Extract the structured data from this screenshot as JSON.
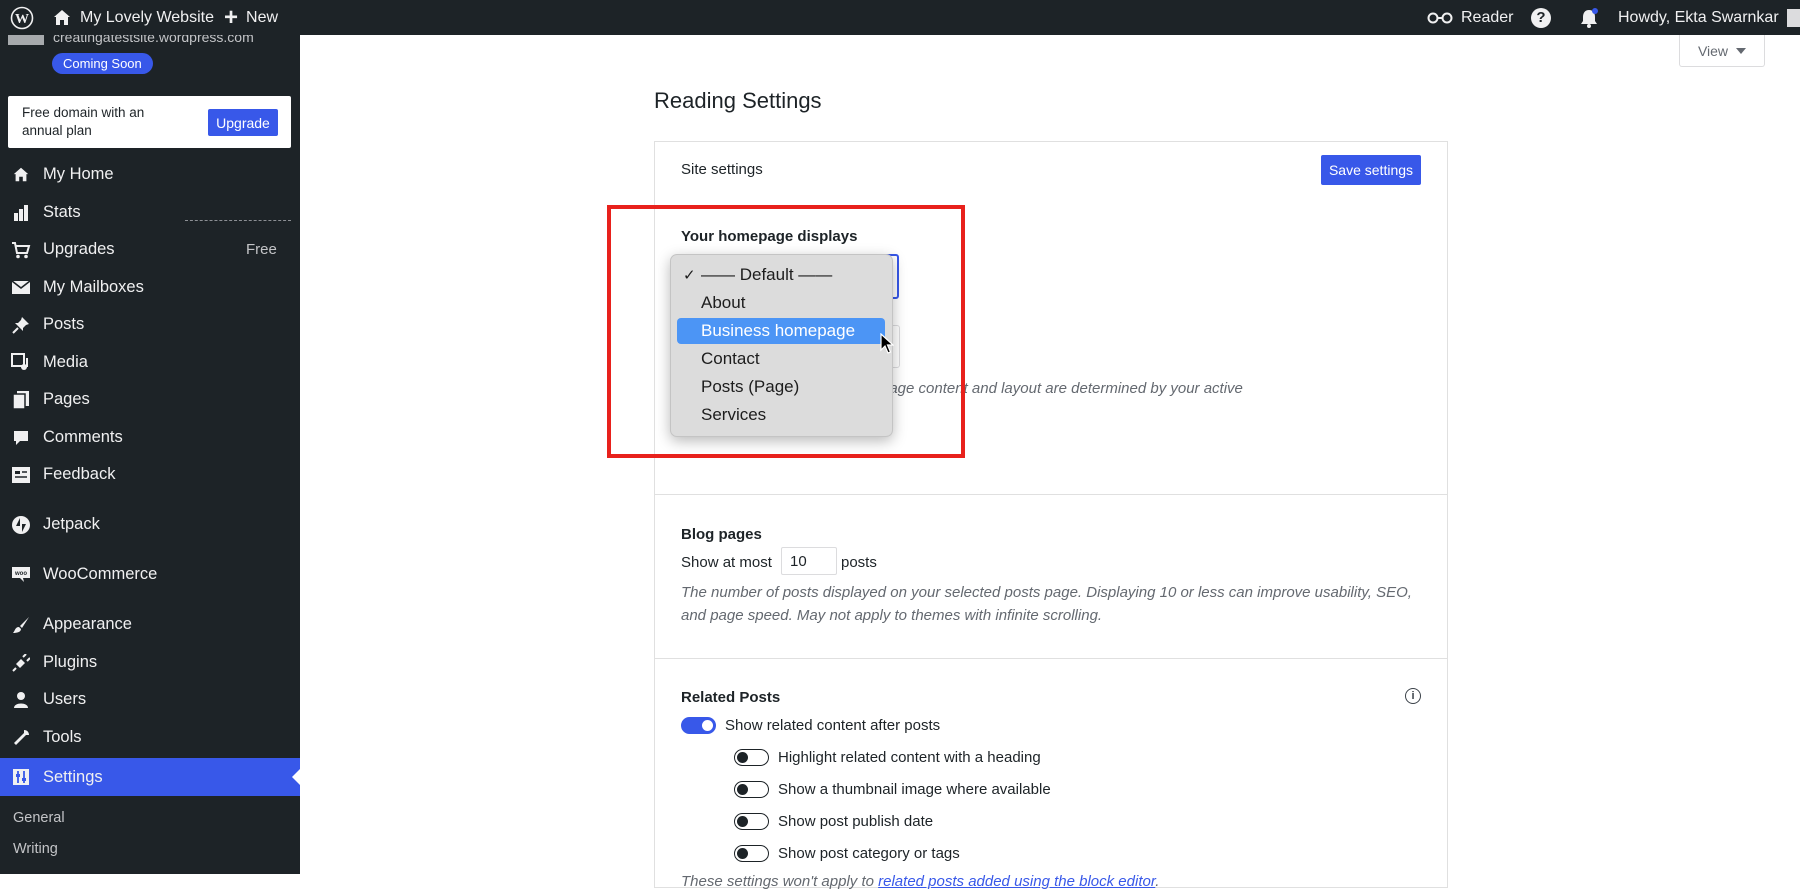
{
  "adminbar": {
    "site_name": "My Lovely Website",
    "new_label": "New",
    "reader_label": "Reader",
    "howdy": "Howdy, Ekta Swarnkar"
  },
  "sidebar": {
    "site_url": "creatingatestsite.wordpress.com",
    "badge": "Coming Soon",
    "promo_text": "Free domain with an annual plan",
    "upgrade_label": "Upgrade",
    "items": [
      {
        "label": "My Home",
        "icon": "home-icon"
      },
      {
        "label": "Stats",
        "icon": "stats-icon"
      },
      {
        "label": "Upgrades",
        "icon": "cart-icon",
        "badge": "Free"
      },
      {
        "label": "My Mailboxes",
        "icon": "mail-icon"
      },
      {
        "label": "Posts",
        "icon": "pin-icon"
      },
      {
        "label": "Media",
        "icon": "media-icon"
      },
      {
        "label": "Pages",
        "icon": "pages-icon"
      },
      {
        "label": "Comments",
        "icon": "comment-icon"
      },
      {
        "label": "Feedback",
        "icon": "feedback-icon"
      },
      {
        "label": "Jetpack",
        "icon": "jetpack-icon"
      },
      {
        "label": "WooCommerce",
        "icon": "woo-icon"
      },
      {
        "label": "Appearance",
        "icon": "brush-icon"
      },
      {
        "label": "Plugins",
        "icon": "plug-icon"
      },
      {
        "label": "Users",
        "icon": "user-icon"
      },
      {
        "label": "Tools",
        "icon": "wrench-icon"
      },
      {
        "label": "Settings",
        "icon": "settings-icon",
        "active": true
      }
    ],
    "submenu": [
      "General",
      "Writing"
    ]
  },
  "main": {
    "view_label": "View",
    "page_title": "Reading Settings",
    "site_settings_label": "Site settings",
    "save_label": "Save settings",
    "homepage": {
      "label": "Your homepage displays",
      "help_fragment": "page content and layout are determined by your active",
      "dropdown": {
        "checked": "—— Default ——",
        "options": [
          "—— Default ——",
          "About",
          "Business homepage",
          "Contact",
          "Posts (Page)",
          "Services"
        ],
        "highlighted": "Business homepage"
      }
    },
    "blog_pages": {
      "label": "Blog pages",
      "show_at_most": "Show at most",
      "value": "10",
      "posts": "posts",
      "help": "The number of posts displayed on your selected posts page. Displaying 10 or less can improve usability, SEO, and page speed. May not apply to themes with infinite scrolling."
    },
    "related_posts": {
      "label": "Related Posts",
      "main_toggle": "Show related content after posts",
      "options": [
        "Highlight related content with a heading",
        "Show a thumbnail image where available",
        "Show post publish date",
        "Show post category or tags"
      ],
      "footer_text": "These settings won't apply to ",
      "footer_link": "related posts added using the block editor",
      "footer_end": "."
    }
  },
  "colors": {
    "accent": "#3858e9",
    "highlight_box": "#e8211c",
    "admin_dark": "#1d2327"
  }
}
